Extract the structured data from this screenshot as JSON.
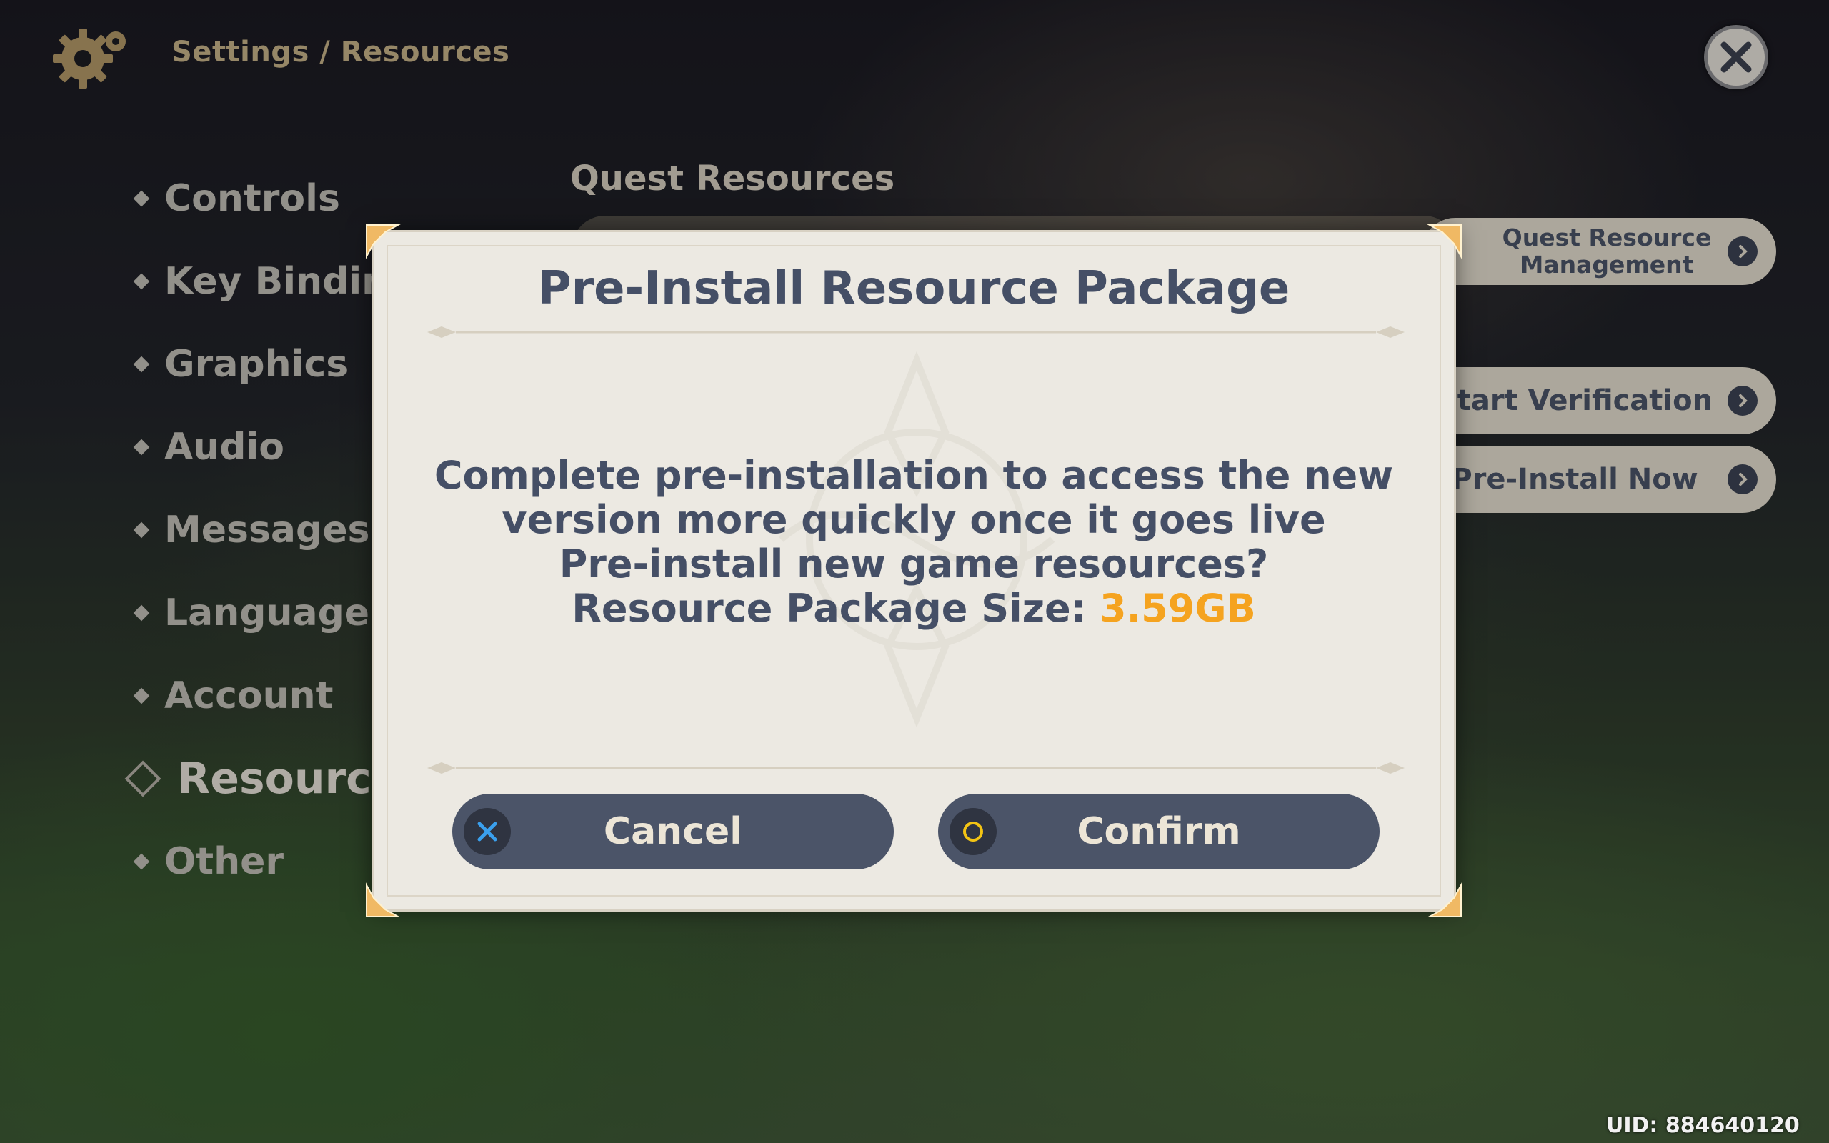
{
  "header": {
    "breadcrumb": "Settings / Resources",
    "settings_icon": "gear-icon",
    "close_icon": "close-icon"
  },
  "sidebar": {
    "items": [
      {
        "label": "Controls",
        "active": false
      },
      {
        "label": "Key Bindings",
        "active": false
      },
      {
        "label": "Graphics",
        "active": false
      },
      {
        "label": "Audio",
        "active": false
      },
      {
        "label": "Messages",
        "active": false
      },
      {
        "label": "Language",
        "active": false
      },
      {
        "label": "Account",
        "active": false
      },
      {
        "label": "Resources",
        "active": true
      },
      {
        "label": "Other",
        "active": false
      }
    ]
  },
  "main": {
    "section_title": "Quest Resources",
    "buttons": {
      "quest_resource_management": "Quest Resource Management",
      "start_verification": "Start Verification",
      "pre_install_now": "Pre-Install Now"
    }
  },
  "dialog": {
    "title": "Pre-Install Resource Package",
    "line1": "Complete pre-installation to access the new",
    "line2": "version more quickly once it goes live",
    "line3": "Pre-install new game resources?",
    "size_label": "Resource Package Size: ",
    "size_value": "3.59GB",
    "cancel_label": "Cancel",
    "confirm_label": "Confirm"
  },
  "footer": {
    "uid": "UID: 884640120"
  },
  "colors": {
    "accent_orange": "#f5a31f",
    "dialog_bg": "#ece9e2",
    "button_dark": "#4b5468",
    "cancel_icon": "#3aa0ee",
    "confirm_icon": "#f3c414"
  }
}
